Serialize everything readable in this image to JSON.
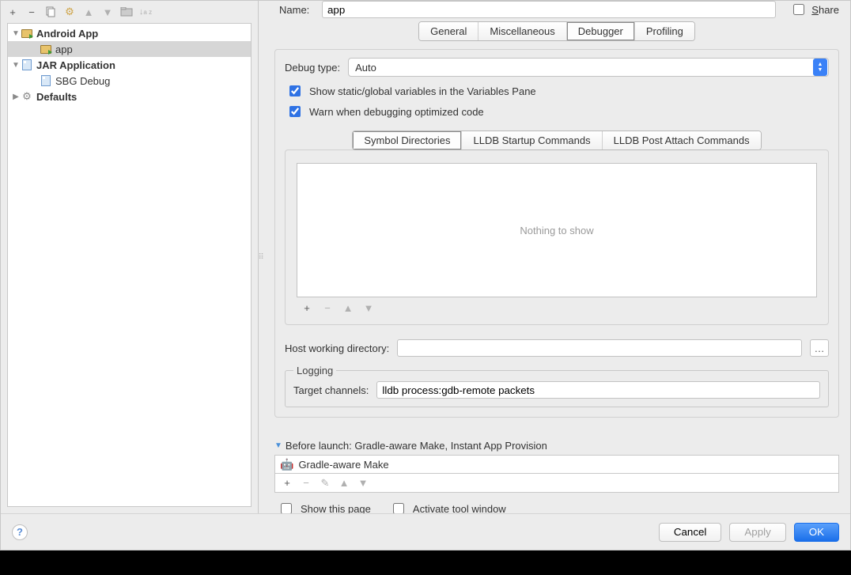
{
  "toolbar": {
    "add": "+",
    "remove": "−",
    "copy": "⧉",
    "settings": "⚙",
    "up": "▲",
    "down": "▼",
    "folder": "📁",
    "sort": "↓ᴬ"
  },
  "tree": {
    "android_app": "Android App",
    "app": "app",
    "jar_app": "JAR Application",
    "sbg": "SBG Debug",
    "defaults": "Defaults"
  },
  "name_label": "Name:",
  "name_value": "app",
  "share": "Share",
  "share_u": "S",
  "tabs": {
    "general": "General",
    "misc": "Miscellaneous",
    "debugger": "Debugger",
    "profiling": "Profiling"
  },
  "debug_type_label": "Debug type:",
  "debug_type_value": "Auto",
  "cb_static": "Show static/global variables in the Variables Pane",
  "cb_warn": "Warn when debugging optimized code",
  "subtabs": {
    "sym": "Symbol Directories",
    "startup": "LLDB Startup Commands",
    "post": "LLDB Post Attach Commands"
  },
  "nothing": "Nothing to show",
  "host_label": "Host working directory:",
  "host_value": "",
  "logging_legend": "Logging",
  "target_channels_label": "Target channels:",
  "target_channels_value": "lldb process:gdb-remote packets",
  "before_header": "Before launch: Gradle-aware Make, Instant App Provision",
  "before_item": "Gradle-aware Make",
  "show_this_page": "Show this page",
  "activate_tool": "Activate tool window",
  "buttons": {
    "cancel": "Cancel",
    "apply": "Apply",
    "ok": "OK"
  },
  "help": "?",
  "dots": "…"
}
